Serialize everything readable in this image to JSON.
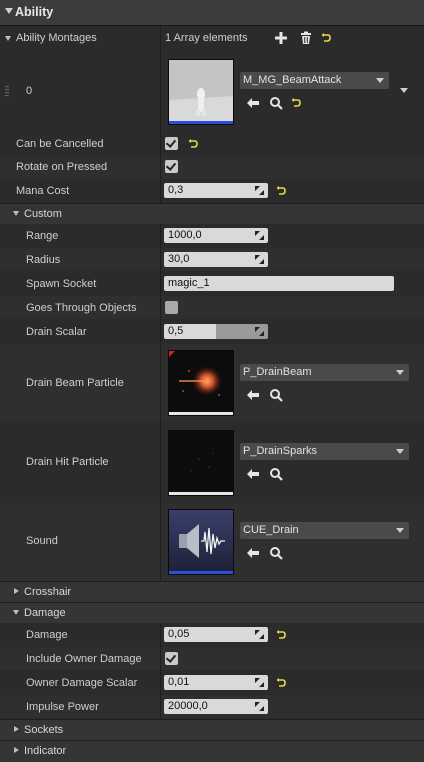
{
  "title": "Ability",
  "montages": {
    "label": "Ability Montages",
    "count_text": "1 Array elements",
    "index": "0",
    "asset": "M_MG_BeamAttack"
  },
  "props_top": [
    {
      "label": "Can be Cancelled",
      "checked": true,
      "resettable": true
    },
    {
      "label": "Rotate on Pressed",
      "checked": true,
      "resettable": false
    }
  ],
  "mana": {
    "label": "Mana Cost",
    "value": "0,3"
  },
  "custom": {
    "section": "Custom",
    "range": {
      "label": "Range",
      "value": "1000,0"
    },
    "radius": {
      "label": "Radius",
      "value": "30,0"
    },
    "spawn_socket": {
      "label": "Spawn Socket",
      "value": "magic_1"
    },
    "goes_through": {
      "label": "Goes Through Objects",
      "checked": false
    },
    "drain_scalar": {
      "label": "Drain Scalar",
      "value": "0,5",
      "fill_fraction": 0.5
    },
    "beam": {
      "label": "Drain Beam Particle",
      "asset": "P_DrainBeam"
    },
    "hit": {
      "label": "Drain Hit Particle",
      "asset": "P_DrainSparks"
    },
    "sound": {
      "label": "Sound",
      "asset": "CUE_Drain"
    }
  },
  "crosshair": {
    "section": "Crosshair"
  },
  "damage": {
    "section": "Damage",
    "damage": {
      "label": "Damage",
      "value": "0,05"
    },
    "include_owner": {
      "label": "Include Owner Damage",
      "checked": true
    },
    "owner_scalar": {
      "label": "Owner Damage Scalar",
      "value": "0,01"
    },
    "impulse": {
      "label": "Impulse Power",
      "value": "20000,0"
    }
  },
  "sockets": {
    "section": "Sockets"
  },
  "indicator": {
    "section": "Indicator"
  },
  "colors": {
    "reset": "#e8d84a",
    "accent_blue": "#2b4fd6"
  }
}
